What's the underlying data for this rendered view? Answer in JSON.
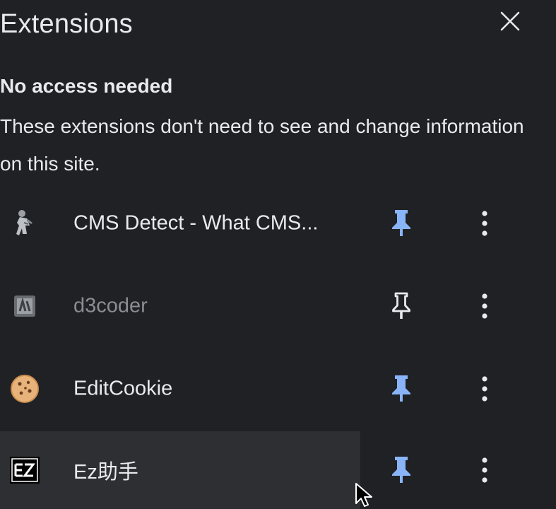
{
  "header": {
    "title": "Extensions",
    "close_icon": "close-icon"
  },
  "section": {
    "heading": "No access needed",
    "description": "These extensions don't need to see and change information on this site."
  },
  "extensions": [
    {
      "name": "CMS Detect - What CMS...",
      "icon": "cms-detect-icon",
      "pinned": true
    },
    {
      "name": "d3coder",
      "icon": "d3coder-icon",
      "pinned": false
    },
    {
      "name": "EditCookie",
      "icon": "cookie-icon",
      "pinned": true
    },
    {
      "name": "Ez助手",
      "icon": "ez-icon",
      "pinned": true
    }
  ],
  "colors": {
    "background": "#202124",
    "pin_active": "#8ab4f8",
    "text": "#e8eaed",
    "muted_text": "#8a8d91",
    "hover": "#2e2f32"
  }
}
